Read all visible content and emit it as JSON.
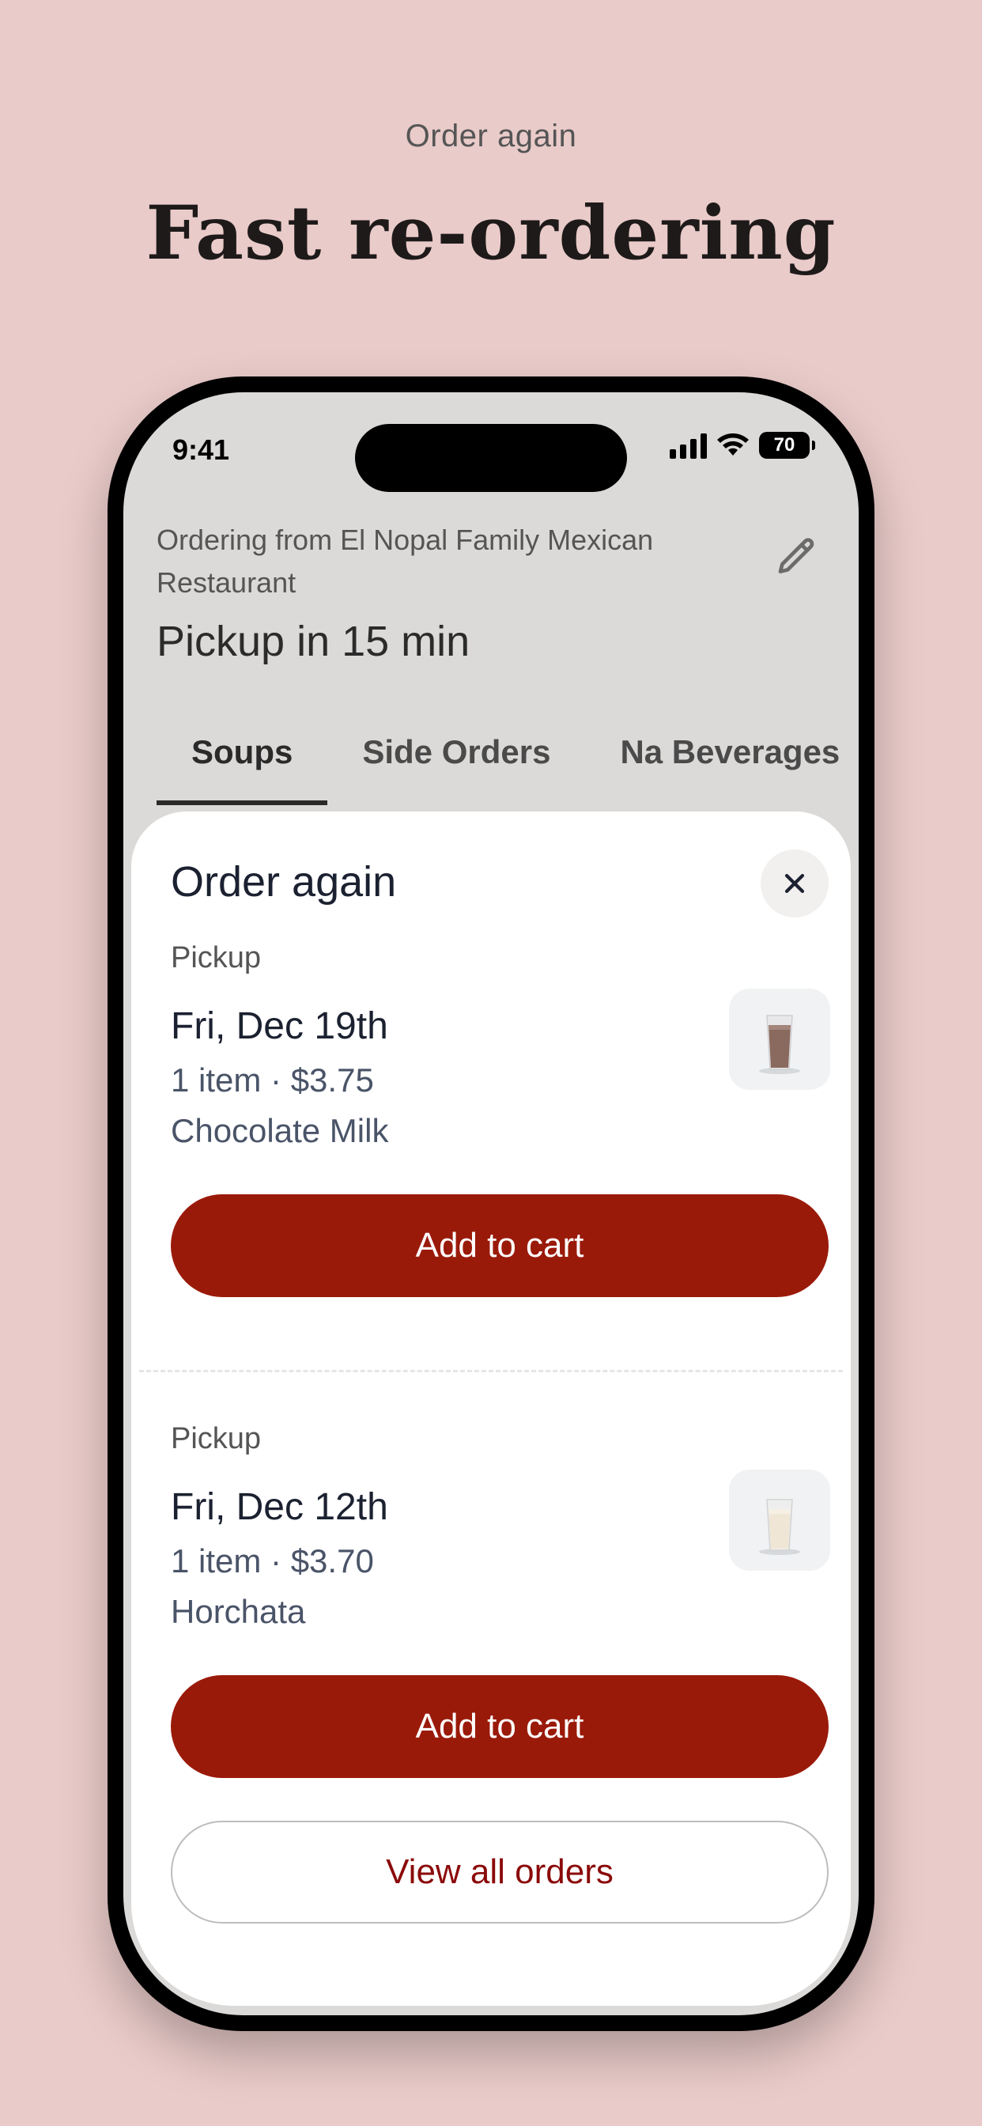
{
  "promo": {
    "eyebrow": "Order again",
    "title": "Fast re-ordering"
  },
  "status_bar": {
    "time": "9:41",
    "battery": "70"
  },
  "header": {
    "ordering_from": "Ordering from El Nopal Family Mexican Restaurant",
    "pickup_eta": "Pickup in 15 min",
    "edit_icon": "pencil-icon"
  },
  "tabs": [
    {
      "label": "Soups",
      "active": true
    },
    {
      "label": "Side Orders",
      "active": false
    },
    {
      "label": "Na Beverages",
      "active": false
    }
  ],
  "sheet": {
    "title": "Order again",
    "close_icon": "close-icon",
    "orders": [
      {
        "type": "Pickup",
        "date": "Fri, Dec 19th",
        "summary": "1 item · $3.75",
        "item": "Chocolate Milk",
        "button": "Add to cart",
        "thumb": "chocolate-milk-image"
      },
      {
        "type": "Pickup",
        "date": "Fri, Dec 12th",
        "summary": "1 item · $3.70",
        "item": "Horchata",
        "button": "Add to cart",
        "thumb": "horchata-image"
      }
    ],
    "view_all": "View all orders"
  },
  "colors": {
    "background": "#E9CBC9",
    "primary_button": "#9A1A0A",
    "link": "#8B0A0A"
  }
}
